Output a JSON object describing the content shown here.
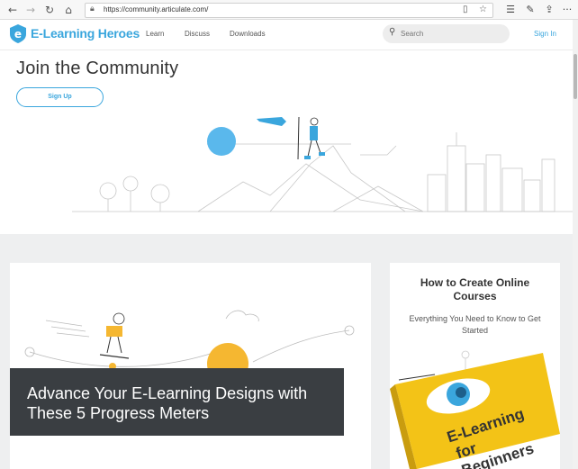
{
  "browser": {
    "url": "https://community.articulate.com/",
    "icons": {
      "back": "back-arrow-icon",
      "forward": "forward-arrow-icon",
      "refresh": "refresh-icon",
      "home": "home-icon",
      "lock": "lock-icon",
      "reading_view": "reading-view-icon",
      "favorite": "star-icon",
      "favorites_hub": "favorites-hub-icon",
      "notes": "pen-icon",
      "share": "share-icon",
      "more": "more-icon"
    }
  },
  "header": {
    "logo_text": "E-Learning Heroes",
    "nav": [
      {
        "label": "Learn"
      },
      {
        "label": "Discuss"
      },
      {
        "label": "Downloads"
      }
    ],
    "search_placeholder": "Search",
    "signin_label": "Sign In"
  },
  "hero": {
    "title": "Join the Community",
    "signup_label": "Sign Up"
  },
  "main_card": {
    "title": "Advance Your E-Learning Designs with These 5 Progress Meters"
  },
  "side_card": {
    "title": "How to Create Online Courses",
    "subtitle": "Everything You Need to Know to Get Started",
    "book_text": "E-Learning for Beginners"
  },
  "colors": {
    "brand": "#3aa6dd",
    "overlay": "#3a3e42",
    "content_bg": "#eeeff0",
    "sun": "#f5b731",
    "book": "#f3c317"
  }
}
